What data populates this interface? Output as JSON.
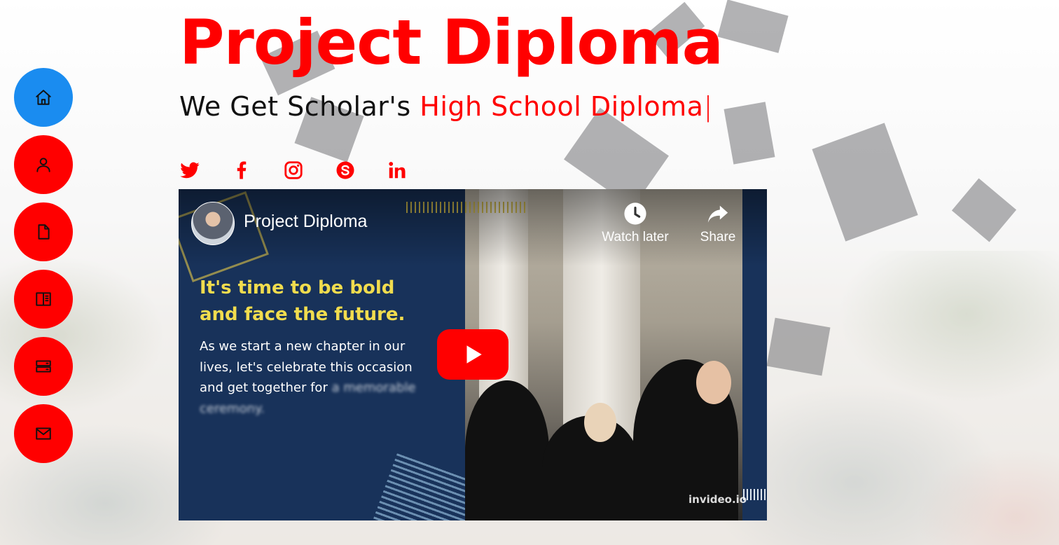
{
  "hero": {
    "title": "Project Diploma",
    "subtitle_prefix": "We Get Scholar's ",
    "subtitle_typed": "High School Diploma",
    "cursor": "|"
  },
  "nav": {
    "items": [
      {
        "name": "home",
        "icon": "home-icon",
        "active": true
      },
      {
        "name": "about",
        "icon": "person-icon",
        "active": false
      },
      {
        "name": "resume",
        "icon": "file-icon",
        "active": false
      },
      {
        "name": "portfolio",
        "icon": "book-half-icon",
        "active": false
      },
      {
        "name": "services",
        "icon": "server-icon",
        "active": false
      },
      {
        "name": "contact",
        "icon": "envelope-icon",
        "active": false
      }
    ]
  },
  "social": [
    "twitter-icon",
    "facebook-icon",
    "instagram-icon",
    "skype-icon",
    "linkedin-icon"
  ],
  "video": {
    "channel_name": "Project Diploma",
    "watch_later": "Watch later",
    "share": "Share",
    "headline": "It's time to be bold and face the future.",
    "body_clear": "As we start a new chapter in our lives, let's celebrate this occasion and get together for",
    "body_blurred": "a memorable ceremony.",
    "watermark": "invideo.io"
  },
  "colors": {
    "accent": "#ff0000",
    "active_nav": "#1a8cf0",
    "video_bg": "#18325a",
    "headline_yellow": "#f1dc4e"
  }
}
